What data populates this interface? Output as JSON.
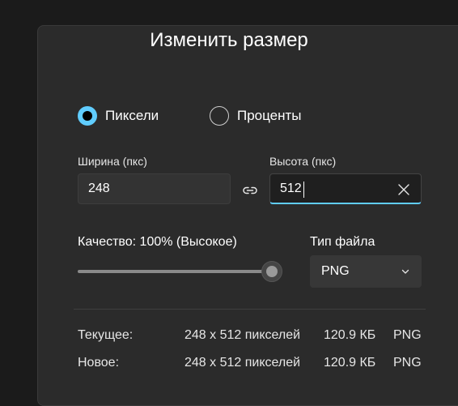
{
  "dialog": {
    "title": "Изменить размер"
  },
  "mode": {
    "options": [
      {
        "label": "Пиксели",
        "checked": true
      },
      {
        "label": "Проценты",
        "checked": false
      }
    ]
  },
  "width": {
    "label": "Ширина (пкс)",
    "value": "248"
  },
  "height": {
    "label": "Высота (пкс)",
    "value": "512"
  },
  "quality": {
    "label": "Качество: 100% (Высокое)",
    "value_percent": 100
  },
  "filetype": {
    "label": "Тип файла",
    "selected": "PNG"
  },
  "info": {
    "current": {
      "label": "Текущее:",
      "dimensions": "248 x 512 пикселей",
      "size": "120.9 КБ",
      "format": "PNG"
    },
    "new": {
      "label": "Новое:",
      "dimensions": "248 x 512 пикселей",
      "size": "120.9 КБ",
      "format": "PNG"
    }
  },
  "colors": {
    "accent": "#60cdff",
    "background": "#1b1b1b",
    "dialog": "#2b2b2b"
  },
  "icons": {
    "link": "link-icon",
    "clear": "close-icon",
    "dropdown": "chevron-down-icon"
  }
}
